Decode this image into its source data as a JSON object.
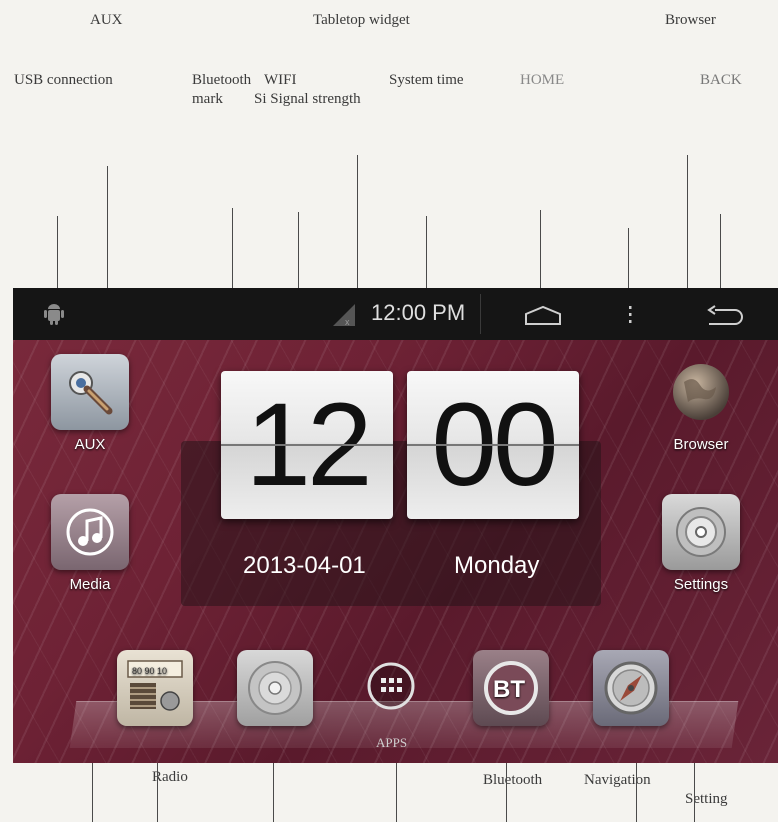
{
  "callouts": {
    "aux": "AUX",
    "tabletop_widget": "Tabletop widget",
    "browser": "Browser",
    "usb_connection": "USB connection",
    "bluetooth_mark_1": "Bluetooth",
    "bluetooth_mark_2": "mark",
    "wifi": "WIFI",
    "signal_strength": "Si Signal strength",
    "system_time": "System time",
    "home": "HOME",
    "back": "BACK",
    "radio": "Radio",
    "bluetooth": "Bluetooth",
    "navigation": "Navigation",
    "setting": "Setting"
  },
  "statusbar": {
    "time": "12:00 PM"
  },
  "clock": {
    "hours": "12",
    "minutes": "00",
    "date": "2013-04-01",
    "weekday": "Monday"
  },
  "apps": {
    "aux": "AUX",
    "media": "Media",
    "browser": "Browser",
    "settings": "Settings"
  },
  "dock": {
    "apps_label": "APPS",
    "radio_dial": "80 90 10",
    "bt_text": "BT"
  },
  "icons": [
    "android-icon",
    "signal-icon",
    "home-icon",
    "menu-icon",
    "back-icon",
    "aux-icon",
    "media-note-icon",
    "globe-icon",
    "settings-disc-icon",
    "radio-icon",
    "dvd-disc-icon",
    "apps-grid-icon",
    "bluetooth-icon",
    "navigation-compass-icon"
  ]
}
